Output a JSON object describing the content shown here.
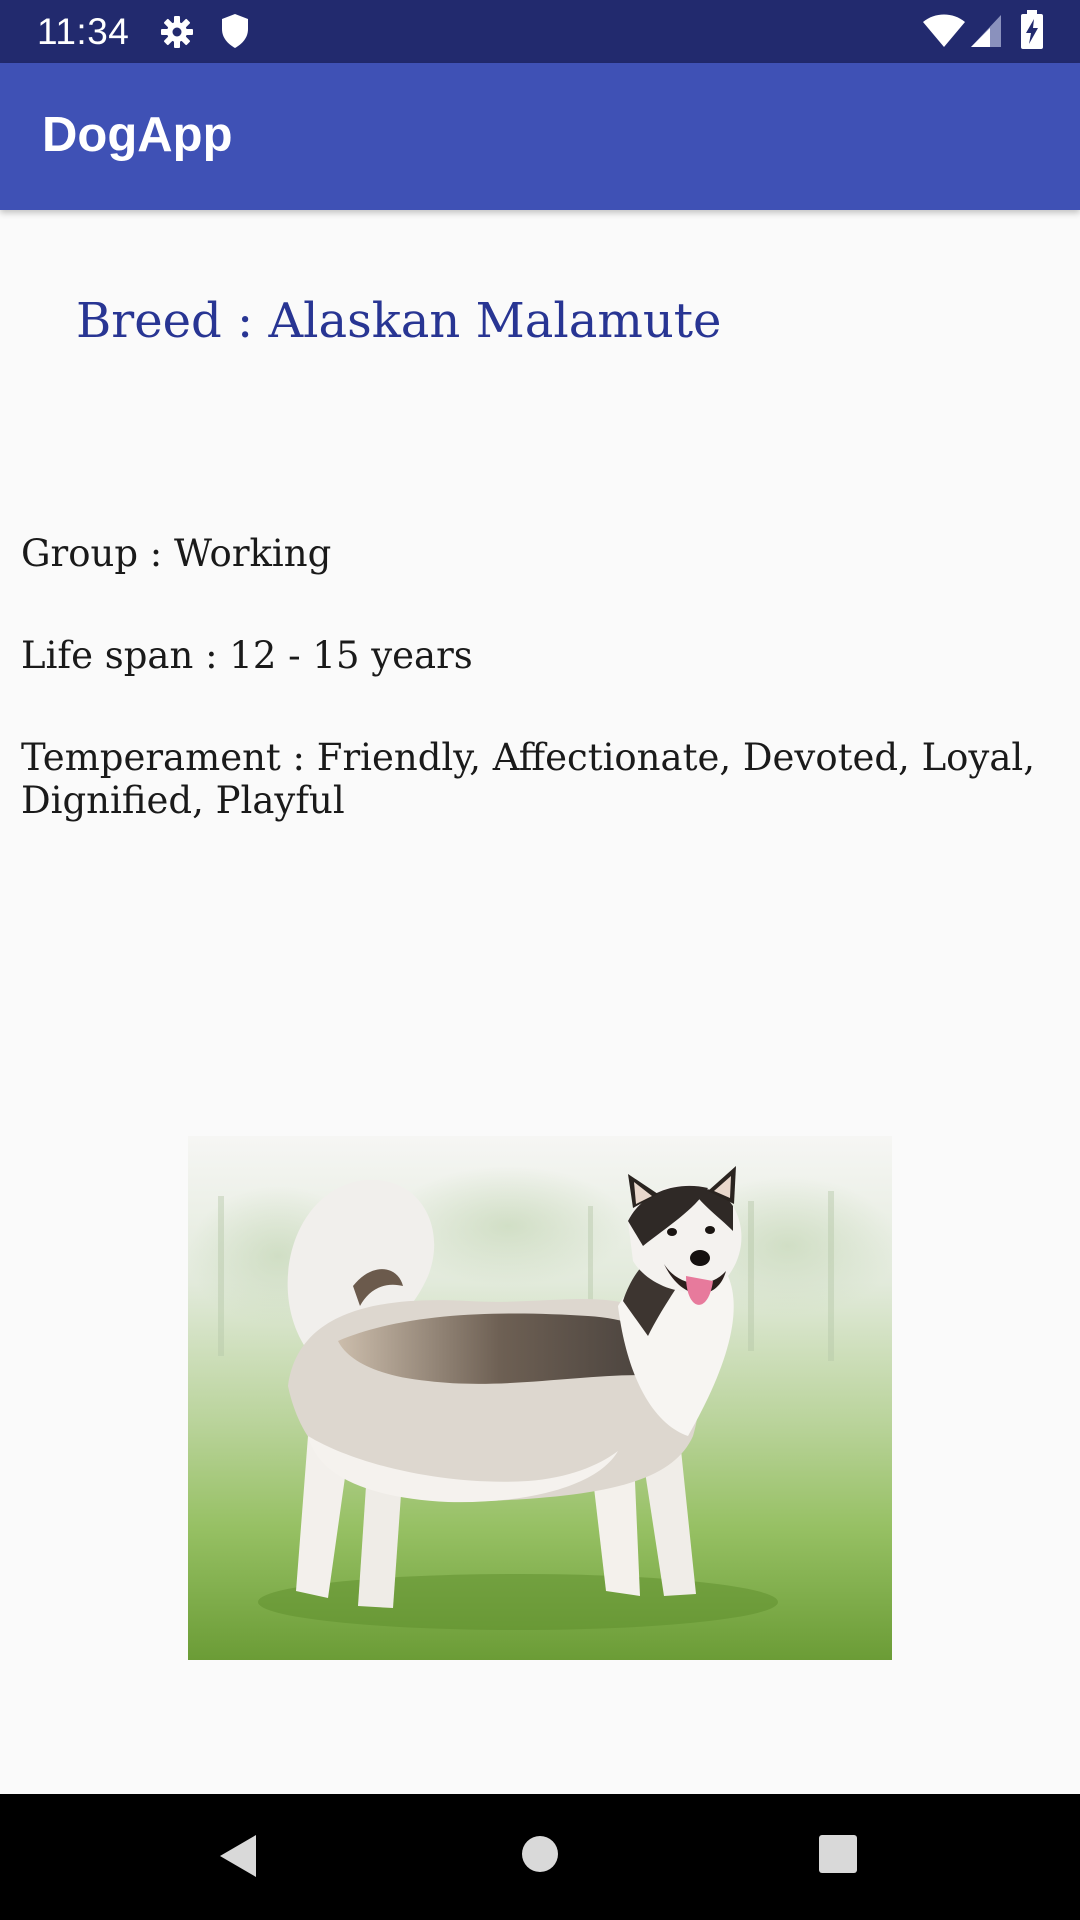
{
  "status_bar": {
    "time": "11:34",
    "icons": [
      "gear-icon",
      "shield-icon",
      "wifi-icon",
      "signal-icon",
      "battery-charging-icon"
    ]
  },
  "app_bar": {
    "title": "DogApp",
    "color": "#3f51b5"
  },
  "breed": {
    "title": "Breed : Alaskan Malamute"
  },
  "details": {
    "group": "Group : Working",
    "life_span": "Life span : 12 - 15 years",
    "temperament": "Temperament : Friendly, Affectionate, Devoted, Loyal, Dignified, Playful"
  },
  "image": {
    "subject": "dog-photo"
  },
  "nav_bar": {
    "buttons": [
      "back-icon",
      "home-icon",
      "recents-icon"
    ]
  },
  "colors": {
    "status_bar": "#222a6e",
    "app_bar": "#3f51b5",
    "title_text": "#283593",
    "background": "#fafafa"
  }
}
